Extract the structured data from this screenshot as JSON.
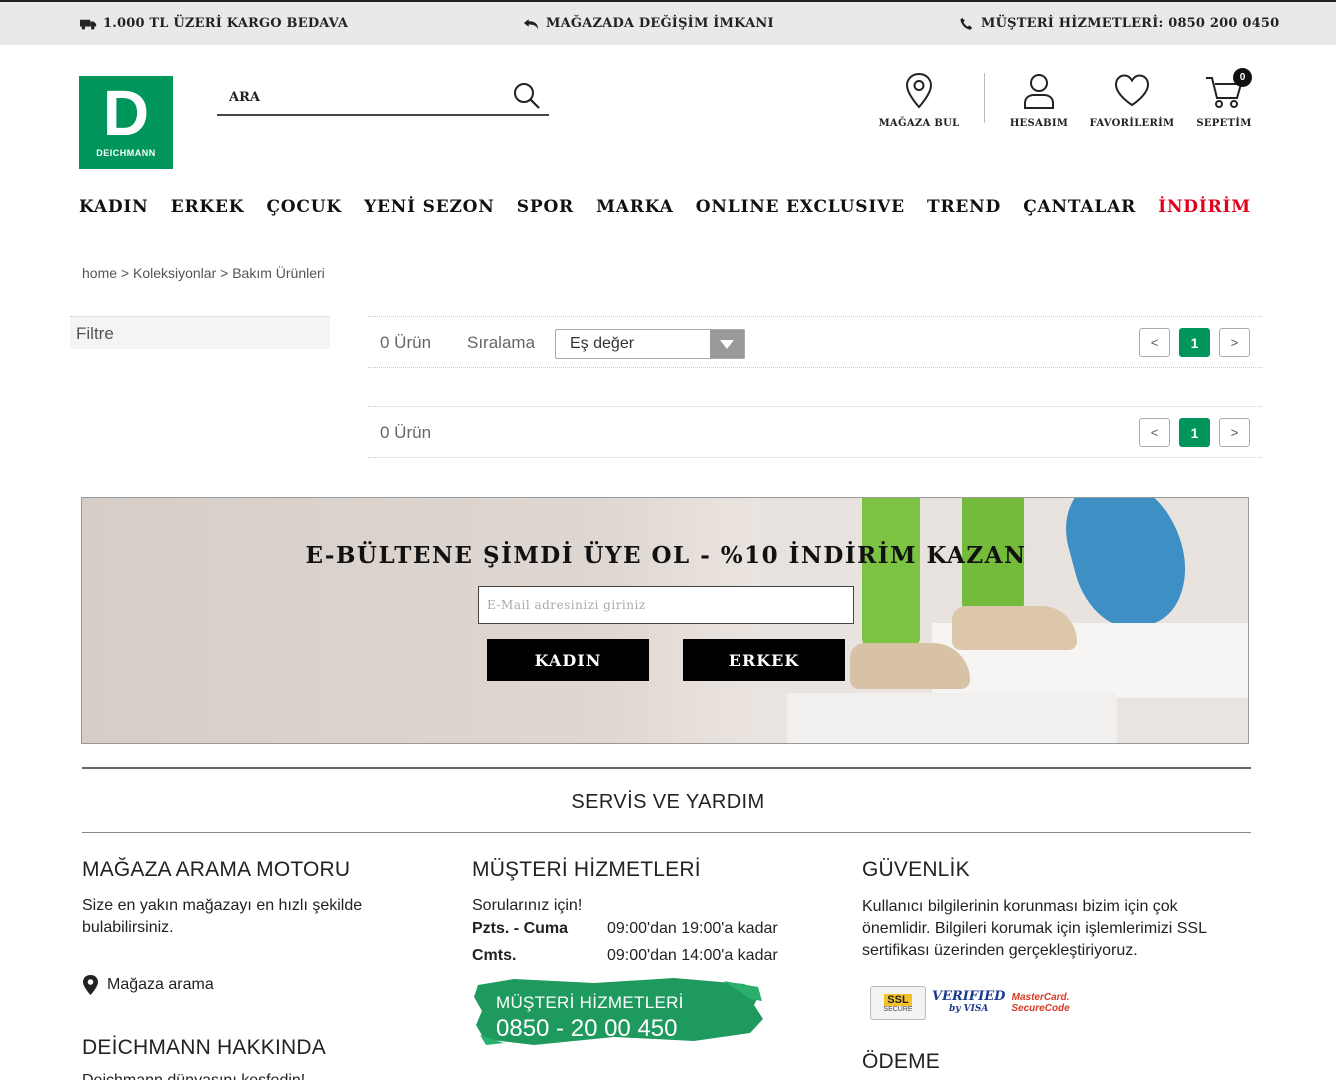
{
  "topbar": {
    "shipping": "1.000 TL ÜZERİ KARGO BEDAVA",
    "exchange": "MAĞAZADA DEĞİŞİM İMKANI",
    "support": "MÜŞTERİ HİZMETLERİ: 0850 200 0450"
  },
  "logo": {
    "letter": "D",
    "name": "DEICHMANN"
  },
  "search": {
    "placeholder": "ARA"
  },
  "header": {
    "store": "MAĞAZA BUL",
    "account": "HESABIM",
    "favorites": "FAVORİLERİM",
    "cart": "SEPETİM",
    "cart_count": "0"
  },
  "nav": {
    "items": [
      "KADIN",
      "ERKEK",
      "ÇOCUK",
      "YENİ SEZON",
      "SPOR",
      "MARKA",
      "ONLINE EXCLUSIVE",
      "TREND",
      "ÇANTALAR",
      "İNDİRİM"
    ]
  },
  "breadcrumb": "home > Koleksiyonlar > Bakım Ürünleri",
  "filter": {
    "label": "Filtre"
  },
  "listing": {
    "count": "0 Ürün",
    "sort_label": "Sıralama",
    "sort_value": "Eş değer",
    "pager": {
      "prev": "<",
      "current": "1",
      "next": ">"
    }
  },
  "newsletter": {
    "title": "E-BÜLTENE ŞİMDİ ÜYE OL - %10 İNDİRİM KAZAN",
    "placeholder": "E-Mail adresinizi giriniz",
    "btn_women": "KADIN",
    "btn_men": "ERKEK"
  },
  "footer": {
    "section_title": "SERVİS VE YARDIM",
    "store_search": {
      "heading": "MAĞAZA ARAMA MOTORU",
      "text": "Size en yakın mağazayı en hızlı şekilde bulabilirsiniz.",
      "link": "Mağaza arama"
    },
    "about": {
      "heading": "DEİCHMANN HAKKINDA",
      "text": "Deichmann dünyasını keşfedin!"
    },
    "customer_service": {
      "heading": "MÜŞTERİ HİZMETLERİ",
      "intro": "Sorularınız için!",
      "weekday_label": "Pzts. - Cuma",
      "weekday_hours": "09:00'dan 19:00'a kadar",
      "saturday_label": "Cmts.",
      "saturday_hours": "09:00'dan 14:00'a kadar",
      "box_title": "MÜŞTERİ HİZMETLERİ",
      "box_phone": "0850 - 20 00 450"
    },
    "security": {
      "heading": "GÜVENLİK",
      "text": "Kullanıcı bilgilerinin korunması bizim için çok önemlidir. Bilgileri korumak için işlemlerimizi SSL sertifikası üzerinden gerçekleştiriyoruz.",
      "badge_ssl": "SSL",
      "badge_ssl_sub": "SECURE",
      "badge_visa_1": "VERIFIED",
      "badge_visa_2": "by VISA",
      "badge_mc_1": "MasterCard.",
      "badge_mc_2": "SecureCode"
    },
    "payment": {
      "heading": "ÖDEME"
    }
  },
  "colors": {
    "brand_green": "#00955a",
    "sale_red": "#e2001a",
    "topbar_bg": "#e9e9e9"
  }
}
